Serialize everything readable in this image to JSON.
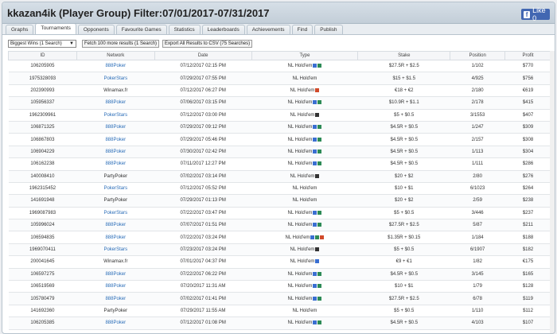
{
  "title": "kkazan4ik (Player Group) Filter:07/01/2017-07/31/2017",
  "facebook": {
    "label": "Like 0"
  },
  "tabs": [
    "Graphs",
    "Tournaments",
    "Opponents",
    "Favourite Games",
    "Statistics",
    "Leaderboards",
    "Achievements",
    "Find",
    "Publish"
  ],
  "active_tab": "Tournaments",
  "toolbar": {
    "filter_select": "Biggest Wins (1 Search)",
    "fetch_button": "Fetch 100 more results (1 Search)",
    "export_button": "Export All Results to CSV (75 Searches)"
  },
  "columns": [
    "ID",
    "Network",
    "Date",
    "Type",
    "Stake",
    "Position",
    "Profit"
  ],
  "rows": [
    {
      "id": "106205905",
      "network": "888Poker",
      "link": true,
      "date": "07/12/2017 02:15 PM",
      "type": "NL Hold'em",
      "icons": [
        "#3a6fd1",
        "#2e8b57"
      ],
      "stake": "$27.5R + $2.5",
      "position": "1/102",
      "profit": "$770"
    },
    {
      "id": "1975328093",
      "network": "PokerStars",
      "link": true,
      "date": "07/29/2017 07:55 PM",
      "type": "NL Hold'em",
      "icons": [],
      "stake": "$15 + $1.5",
      "position": "4/925",
      "profit": "$756"
    },
    {
      "id": "202390993",
      "network": "Winamax.fr",
      "link": false,
      "date": "07/12/2017 06:27 PM",
      "type": "NL Hold'em",
      "icons": [
        "#d14a2a"
      ],
      "stake": "€18 + €2",
      "position": "2/180",
      "profit": "€619"
    },
    {
      "id": "105956337",
      "network": "888Poker",
      "link": true,
      "date": "07/06/2017 03:15 PM",
      "type": "NL Hold'em",
      "icons": [
        "#3a6fd1",
        "#2e8b57"
      ],
      "stake": "$10.9R + $1.1",
      "position": "2/178",
      "profit": "$415"
    },
    {
      "id": "1962309961",
      "network": "PokerStars",
      "link": true,
      "date": "07/12/2017 03:00 PM",
      "type": "NL Hold'em",
      "icons": [
        "#333333"
      ],
      "stake": "$5 + $0.5",
      "position": "3/1553",
      "profit": "$407"
    },
    {
      "id": "106871325",
      "network": "888Poker",
      "link": true,
      "date": "07/29/2017 09:12 PM",
      "type": "NL Hold'em",
      "icons": [
        "#3a6fd1",
        "#2e8b57"
      ],
      "stake": "$4.5R + $0.5",
      "position": "1/247",
      "profit": "$309"
    },
    {
      "id": "106867803",
      "network": "888Poker",
      "link": true,
      "date": "07/29/2017 05:46 PM",
      "type": "NL Hold'em",
      "icons": [
        "#3a6fd1",
        "#2e8b57"
      ],
      "stake": "$4.5R + $0.5",
      "position": "2/157",
      "profit": "$308"
    },
    {
      "id": "106904229",
      "network": "888Poker",
      "link": true,
      "date": "07/30/2017 02:42 PM",
      "type": "NL Hold'em",
      "icons": [
        "#3a6fd1",
        "#2e8b57"
      ],
      "stake": "$4.5R + $0.5",
      "position": "1/113",
      "profit": "$304"
    },
    {
      "id": "106162238",
      "network": "888Poker",
      "link": true,
      "date": "07/11/2017 12:27 PM",
      "type": "NL Hold'em",
      "icons": [
        "#3a6fd1",
        "#2e8b57"
      ],
      "stake": "$4.5R + $0.5",
      "position": "1/111",
      "profit": "$286"
    },
    {
      "id": "140008410",
      "network": "PartyPoker",
      "link": false,
      "date": "07/02/2017 03:14 PM",
      "type": "NL Hold'em",
      "icons": [
        "#333333"
      ],
      "stake": "$20 + $2",
      "position": "2/80",
      "profit": "$276"
    },
    {
      "id": "1962315452",
      "network": "PokerStars",
      "link": true,
      "date": "07/12/2017 05:52 PM",
      "type": "NL Hold'em",
      "icons": [],
      "stake": "$10 + $1",
      "position": "6/1023",
      "profit": "$264"
    },
    {
      "id": "141691948",
      "network": "PartyPoker",
      "link": false,
      "date": "07/29/2017 01:13 PM",
      "type": "NL Hold'em",
      "icons": [],
      "stake": "$20 + $2",
      "position": "2/59",
      "profit": "$238"
    },
    {
      "id": "1969087983",
      "network": "PokerStars",
      "link": true,
      "date": "07/22/2017 03:47 PM",
      "type": "NL Hold'em",
      "icons": [
        "#3a6fd1",
        "#2e8b57"
      ],
      "stake": "$5 + $0.5",
      "position": "3/446",
      "profit": "$237"
    },
    {
      "id": "105996024",
      "network": "888Poker",
      "link": true,
      "date": "07/07/2017 01:51 PM",
      "type": "NL Hold'em",
      "icons": [
        "#3a6fd1",
        "#2e8b57"
      ],
      "stake": "$27.5R + $2.5",
      "position": "5/87",
      "profit": "$211"
    },
    {
      "id": "106594835",
      "network": "888Poker",
      "link": true,
      "date": "07/22/2017 03:24 PM",
      "type": "NL Hold'em",
      "icons": [
        "#3a6fd1",
        "#2e8b57",
        "#d14a2a"
      ],
      "stake": "$1.35R + $0.15",
      "position": "1/184",
      "profit": "$188"
    },
    {
      "id": "1969070411",
      "network": "PokerStars",
      "link": true,
      "date": "07/23/2017 03:24 PM",
      "type": "NL Hold'em",
      "icons": [
        "#333333"
      ],
      "stake": "$5 + $0.5",
      "position": "6/1907",
      "profit": "$182"
    },
    {
      "id": "200041645",
      "network": "Winamax.fr",
      "link": false,
      "date": "07/01/2017 04:37 PM",
      "type": "NL Hold'em",
      "icons": [
        "#3a6fd1"
      ],
      "stake": "€9 + €1",
      "position": "1/82",
      "profit": "€175"
    },
    {
      "id": "106597275",
      "network": "888Poker",
      "link": true,
      "date": "07/22/2017 06:22 PM",
      "type": "NL Hold'em",
      "icons": [
        "#3a6fd1",
        "#2e8b57"
      ],
      "stake": "$4.5R + $0.5",
      "position": "3/145",
      "profit": "$165"
    },
    {
      "id": "106519569",
      "network": "888Poker",
      "link": true,
      "date": "07/20/2017 11:31 AM",
      "type": "NL Hold'em",
      "icons": [
        "#3a6fd1",
        "#2e8b57"
      ],
      "stake": "$10 + $1",
      "position": "1/79",
      "profit": "$128"
    },
    {
      "id": "105780479",
      "network": "888Poker",
      "link": true,
      "date": "07/02/2017 01:41 PM",
      "type": "NL Hold'em",
      "icons": [
        "#3a6fd1",
        "#2e8b57"
      ],
      "stake": "$27.5R + $2.5",
      "position": "6/78",
      "profit": "$119"
    },
    {
      "id": "141692360",
      "network": "PartyPoker",
      "link": false,
      "date": "07/29/2017 11:55 AM",
      "type": "NL Hold'em",
      "icons": [],
      "stake": "$5 + $0.5",
      "position": "1/110",
      "profit": "$112"
    },
    {
      "id": "106205385",
      "network": "888Poker",
      "link": true,
      "date": "07/12/2017 01:08 PM",
      "type": "NL Hold'em",
      "icons": [
        "#3a6fd1",
        "#2e8b57"
      ],
      "stake": "$4.5R + $0.5",
      "position": "4/103",
      "profit": "$107"
    },
    {
      "id": "200774904",
      "network": "Winamax.fr",
      "link": false,
      "date": "07/12/2017 11:28 AM",
      "type": "NL Hold'em",
      "icons": [
        "#3a6fd1"
      ],
      "stake": "€9 + €1",
      "position": "2/65",
      "profit": "€104"
    }
  ]
}
